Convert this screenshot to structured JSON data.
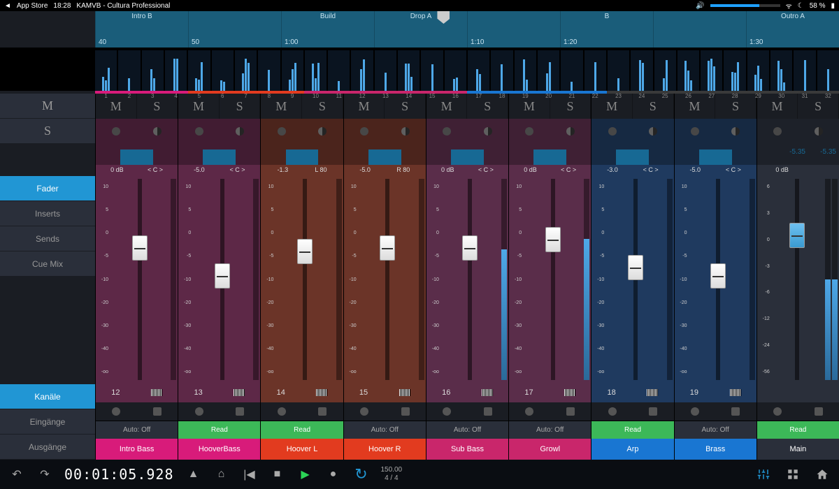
{
  "statusbar": {
    "back": "App Store",
    "time": "18:28",
    "app": "KAMVB - Cultura Professional",
    "battery": "58 %"
  },
  "timeline": {
    "regions": [
      {
        "label": "Intro B",
        "time": "40"
      },
      {
        "label": "",
        "time": "50"
      },
      {
        "label": "Build",
        "time": "1:00"
      },
      {
        "label": "Drop A",
        "time": ""
      },
      {
        "label": "",
        "time": "1:10"
      },
      {
        "label": "B",
        "time": "1:20"
      },
      {
        "label": "",
        "time": ""
      },
      {
        "label": "Outro A",
        "time": "1:30"
      }
    ]
  },
  "thumbs": [
    1,
    2,
    3,
    4,
    5,
    6,
    7,
    8,
    9,
    10,
    11,
    12,
    13,
    14,
    15,
    16,
    17,
    18,
    19,
    20,
    21,
    22,
    23,
    24,
    25,
    26,
    27,
    28,
    29,
    30,
    31,
    32
  ],
  "stripcolors": [
    "#d81b7a",
    "#d81b7a",
    "#d81b7a",
    "#d81b7a",
    "#e23b1f",
    "#e23b1f",
    "#e23b1f",
    "#e23b1f",
    "#e23b1f",
    "#c9266b",
    "#c9266b",
    "#c9266b",
    "#c9266b",
    "#c9266b",
    "#c9266b",
    "#c9266b",
    "#1976d2",
    "#1976d2",
    "#1976d2",
    "#1976d2",
    "#1976d2",
    "#1976d2",
    "#3a3a3a",
    "#3a3a3a",
    "#3a3a3a",
    "#3a3a3a",
    "#3a3a3a",
    "#3a3a3a",
    "#3a3a3a",
    "#3a3a3a",
    "#3a3a3a",
    "#3a3a3a"
  ],
  "sidebar": {
    "m": "M",
    "s": "S",
    "tabs": [
      "Fader",
      "Inserts",
      "Sends",
      "Cue Mix"
    ],
    "active_tab": 0,
    "bottom": [
      "Kanäle",
      "Eingänge",
      "Ausgänge"
    ],
    "active_bottom": 0
  },
  "scale": [
    "10",
    "5",
    "0",
    "-5",
    "-10",
    "-20",
    "-30",
    "-40",
    "-oo"
  ],
  "scale2": [
    "6",
    "3",
    "0",
    "-3",
    "-6",
    "-12",
    "-24",
    "-56"
  ],
  "channels": [
    {
      "db": "0 dB",
      "pan": "< C >",
      "num": "12",
      "auto": "Auto: Off",
      "name": "Intro Bass",
      "bg": "bg-purple",
      "nameC": "name-pink",
      "knob": 28,
      "meter": 0,
      "read": false,
      "peak": ""
    },
    {
      "db": "-5.0",
      "pan": "< C >",
      "num": "13",
      "auto": "Read",
      "name": "HooverBass",
      "bg": "bg-purple",
      "nameC": "name-pink",
      "knob": 42,
      "meter": 0,
      "read": true,
      "peak": ""
    },
    {
      "db": "-1.3",
      "pan": "L 80",
      "num": "14",
      "auto": "Read",
      "name": "Hoover L",
      "bg": "bg-maroon",
      "nameC": "name-red",
      "knob": 30,
      "meter": 0,
      "read": true,
      "peak": ""
    },
    {
      "db": "-5.0",
      "pan": "R 80",
      "num": "15",
      "auto": "Auto: Off",
      "name": "Hoover R",
      "bg": "bg-maroon",
      "nameC": "name-red",
      "knob": 28,
      "meter": 0,
      "read": false,
      "peak": ""
    },
    {
      "db": "0 dB",
      "pan": "< C >",
      "num": "16",
      "auto": "Auto: Off",
      "name": "Sub Bass",
      "bg": "bg-plum",
      "nameC": "name-mag",
      "knob": 28,
      "meter": 65,
      "read": false,
      "peak": ""
    },
    {
      "db": "0 dB",
      "pan": "< C >",
      "num": "17",
      "auto": "Auto: Off",
      "name": "Growl",
      "bg": "bg-plum",
      "nameC": "name-mag",
      "knob": 24,
      "meter": 70,
      "read": false,
      "peak": ""
    },
    {
      "db": "-3.0",
      "pan": "< C >",
      "num": "18",
      "auto": "Read",
      "name": "Arp",
      "bg": "bg-navy",
      "nameC": "name-blue",
      "knob": 38,
      "meter": 0,
      "read": true,
      "peak": ""
    },
    {
      "db": "-5.0",
      "pan": "< C >",
      "num": "19",
      "auto": "Auto: Off",
      "name": "Brass",
      "bg": "bg-navy",
      "nameC": "name-blue",
      "knob": 42,
      "meter": 0,
      "read": false,
      "peak": ""
    },
    {
      "db": "0 dB",
      "pan": "",
      "num": "",
      "auto": "Read",
      "name": "Main",
      "bg": "bg-dark",
      "nameC": "name-gray",
      "knob": 22,
      "meter": 50,
      "read": true,
      "peak": "-5.35",
      "main": true
    }
  ],
  "transport": {
    "tc": "00:01:05.928",
    "tempo": "150.00",
    "sig": "4 / 4"
  }
}
